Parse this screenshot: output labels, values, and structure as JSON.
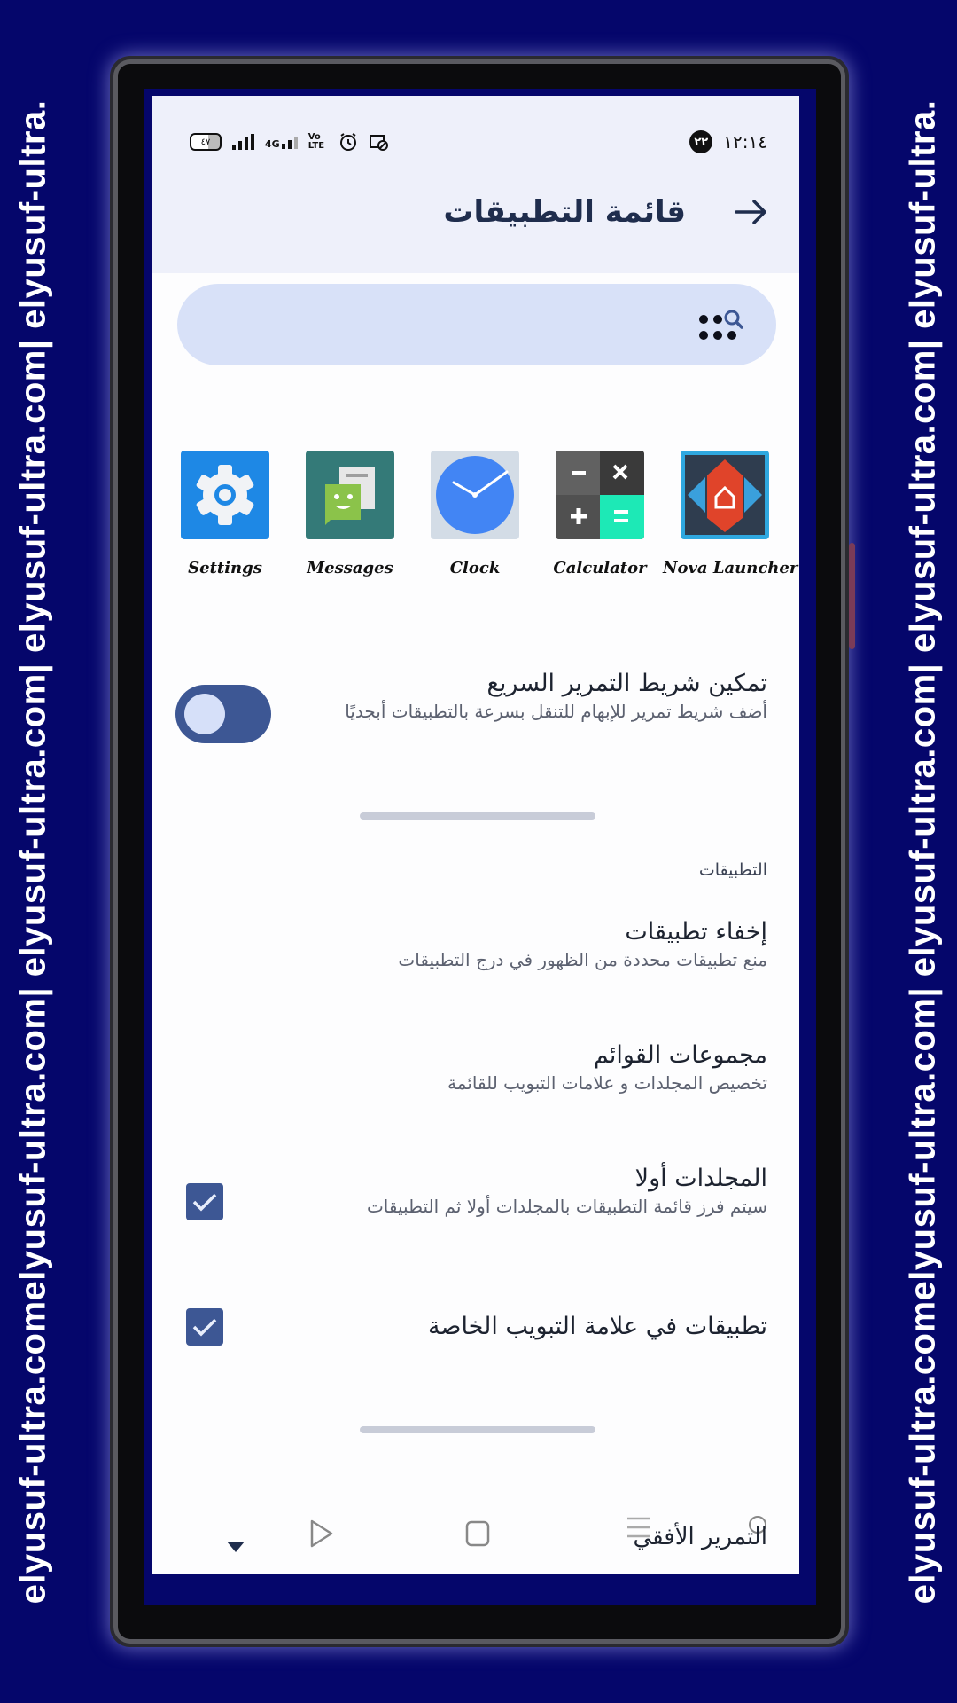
{
  "watermark": {
    "text": "elyusuf-ultra.comelyusuf-ultra.com| elyusuf-ultra.com| elyusuf-ultra.com| elyusuf-ultra."
  },
  "status_bar": {
    "battery": "٤٧",
    "network": "4G",
    "volte": "Vo LTE",
    "notification_count": "٢٢",
    "time": "١٢:١٤"
  },
  "header": {
    "title": "قائمة التطبيقات",
    "back_icon": "arrow-back-icon"
  },
  "search": {
    "placeholder": "",
    "icon": "app-search-icon"
  },
  "apps": [
    {
      "label": "Settings",
      "icon": "settings-gear-icon",
      "color": "#1e88e5"
    },
    {
      "label": "Messages",
      "icon": "messages-icon",
      "color": "#347a78"
    },
    {
      "label": "Clock",
      "icon": "clock-icon",
      "color": "#4285f4"
    },
    {
      "label": "Calculator",
      "icon": "calculator-icon",
      "color": "#424242"
    },
    {
      "label": "Nova Launcher",
      "icon": "nova-launcher-icon",
      "color": "#d84315"
    }
  ],
  "fast_scroll": {
    "title": "تمكين شريط التمرير السريع",
    "subtitle": "أضف شريط تمرير للإبهام للتنقل بسرعة بالتطبيقات أبجديًا",
    "enabled": true
  },
  "section_apps": {
    "header": "التطبيقات"
  },
  "hide_apps": {
    "title": "إخفاء تطبيقات",
    "subtitle": "منع تطبيقات محددة من الظهور في درج التطبيقات"
  },
  "list_groups": {
    "title": "مجموعات القوائم",
    "subtitle": "تخصيص المجلدات و علامات التبويب للقائمة"
  },
  "folders_first": {
    "title": "المجلدات أولا",
    "subtitle": "سيتم فرز قائمة التطبيقات بالمجلدات أولا ثم التطبيقات",
    "checked": true
  },
  "apps_in_own_tab": {
    "title": "تطبيقات في علامة التبويب الخاصة",
    "checked": true
  },
  "horizontal_scroll": {
    "title": "التمرير الأفقي"
  },
  "colors": {
    "accent": "#3d5794",
    "background": "#05066b",
    "header_bg": "#eef0fa",
    "search_bg": "#d8e1f8"
  }
}
